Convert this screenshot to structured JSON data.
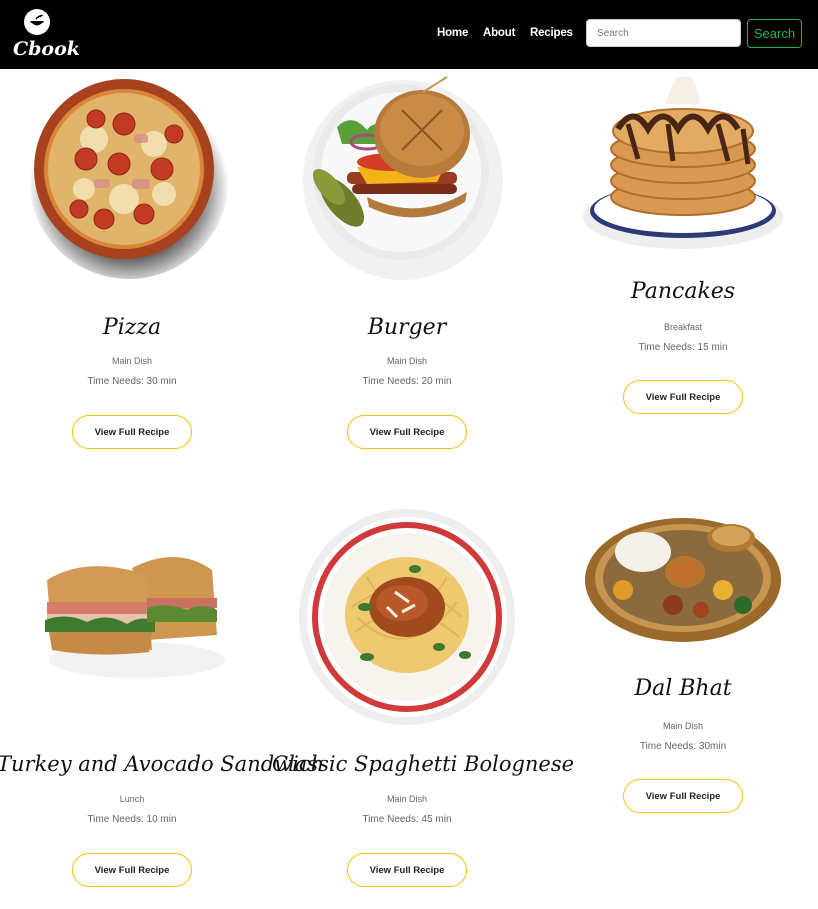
{
  "brand": {
    "name": "Cbook",
    "icon": "cooking-pot-icon"
  },
  "nav": {
    "links": [
      {
        "label": "Home"
      },
      {
        "label": "About"
      },
      {
        "label": "Recipes"
      }
    ],
    "search_placeholder": "Search",
    "search_button": "Search"
  },
  "colors": {
    "navbar": "#000000",
    "search_accent": "#2bb24c",
    "button_border": "#f2c200"
  },
  "recipes": [
    {
      "title": "Pizza",
      "category": "Main Dish",
      "time": "Time Needs: 30 min",
      "button": "View Full Recipe",
      "image": "pizza-image"
    },
    {
      "title": "Burger",
      "category": "Main Dish",
      "time": "Time Needs: 20 min",
      "button": "View Full Recipe",
      "image": "burger-image"
    },
    {
      "title": "Pancakes",
      "category": "Breakfast",
      "time": "Time Needs: 15 min",
      "button": "View Full Recipe",
      "image": "pancakes-image"
    },
    {
      "title": "Turkey and Avocado Sandwich",
      "category": "Lunch",
      "time": "Time Needs: 10 min",
      "button": "View Full Recipe",
      "image": "sandwich-image"
    },
    {
      "title": "Classic Spaghetti Bolognese",
      "category": "Main Dish",
      "time": "Time Needs: 45 min",
      "button": "View Full Recipe",
      "image": "spaghetti-image"
    },
    {
      "title": "Dal Bhat",
      "category": "Main Dish",
      "time": "Time Needs: 30min",
      "button": "View Full Recipe",
      "image": "dal-bhat-image"
    }
  ]
}
